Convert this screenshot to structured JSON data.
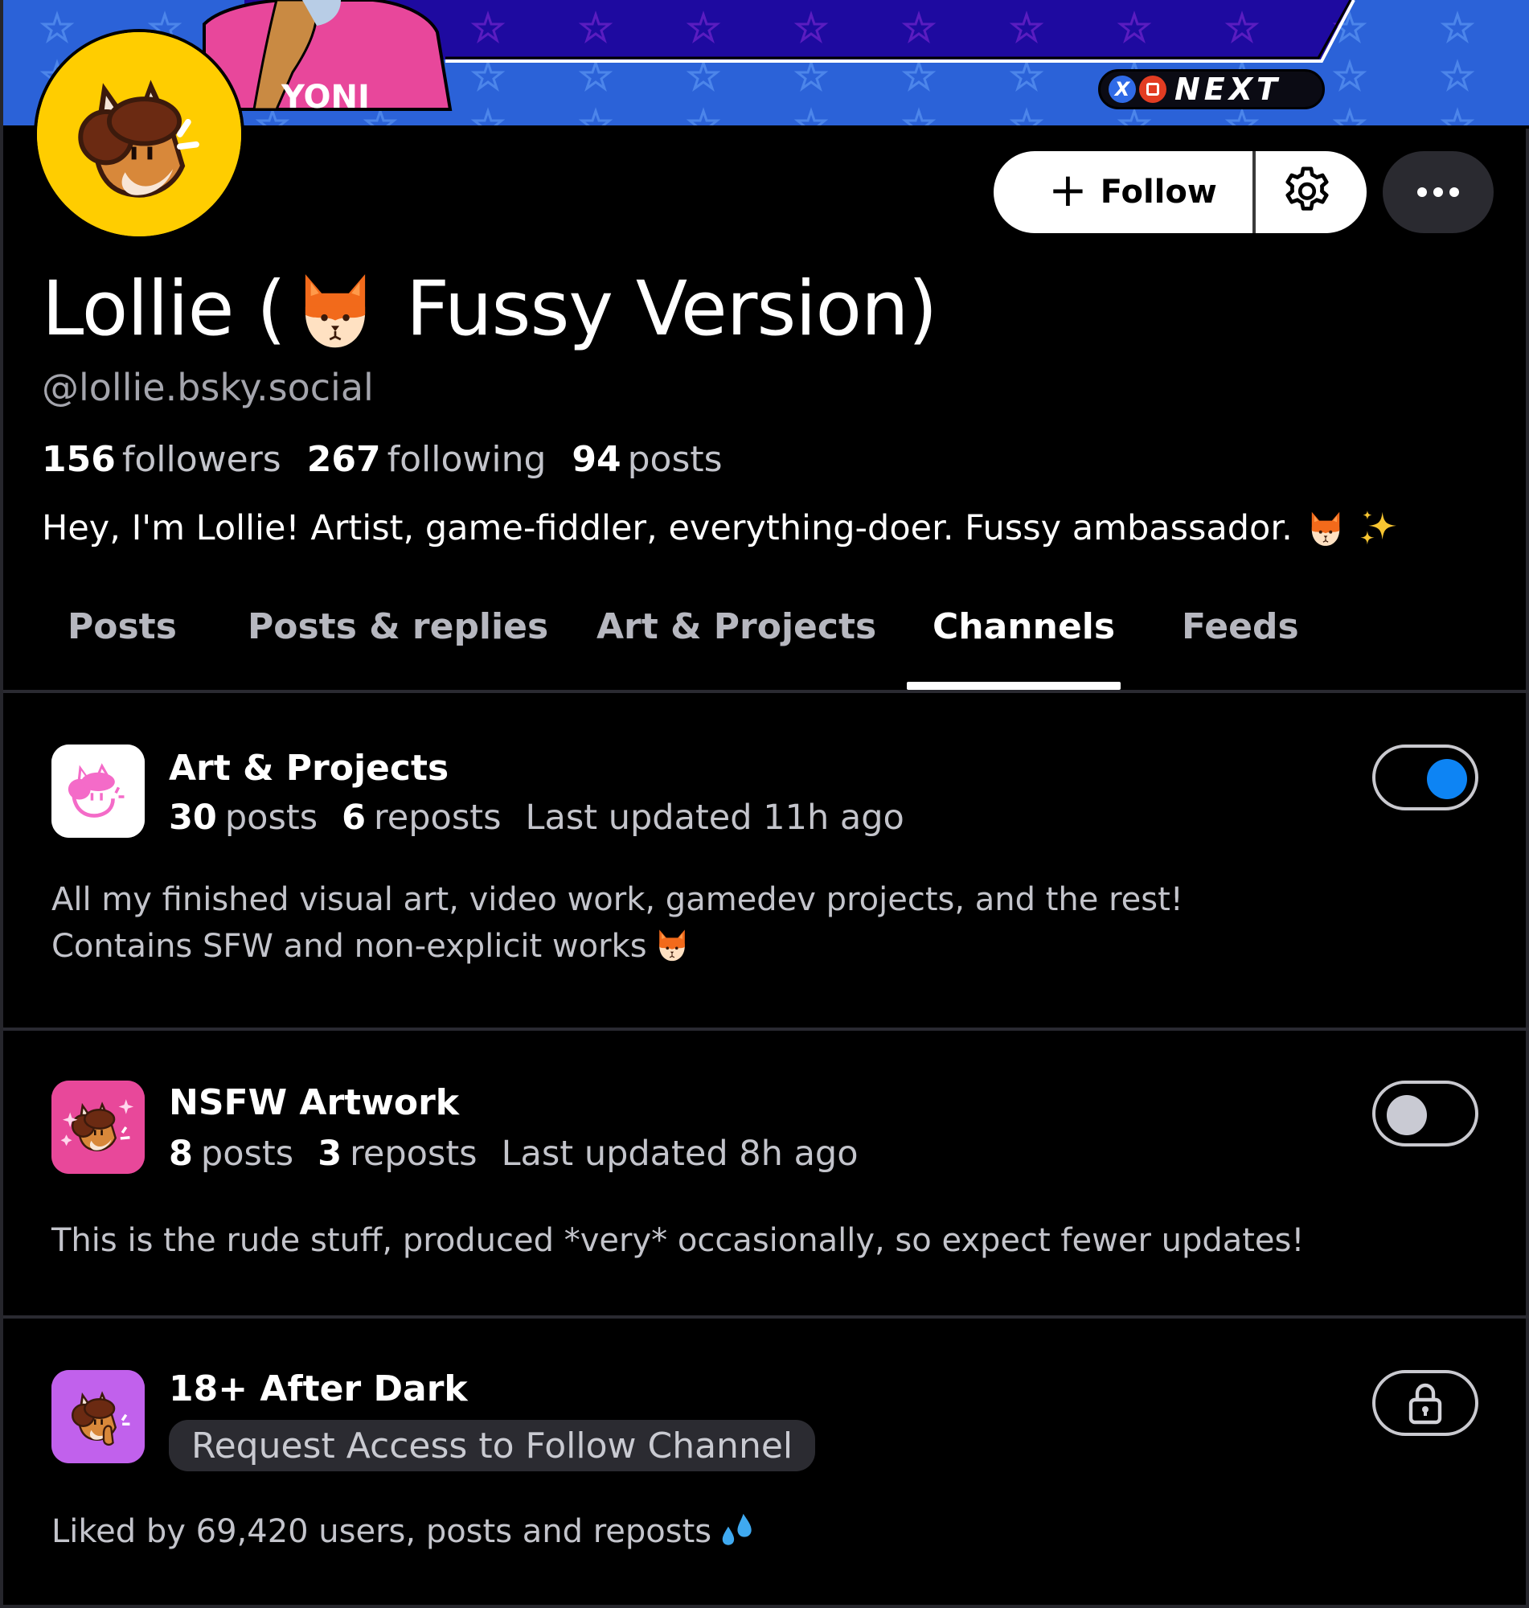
{
  "banner": {
    "badge_text": "NEXT",
    "badge_button_x": "X",
    "shirt_text": "YONI",
    "colors": {
      "sky": "#2b62d8",
      "panel": "#1e0aa0",
      "shirt": "#e8479b"
    }
  },
  "profile": {
    "display_name_before": "Lollie (",
    "display_name_emoji": "fox-face",
    "display_name_after": "Fussy Version)",
    "handle": "@lollie.bsky.social",
    "stats": {
      "followers_count": "156",
      "followers_label": "followers",
      "following_count": "267",
      "following_label": "following",
      "posts_count": "94",
      "posts_label": "posts"
    },
    "bio": "Hey, I'm Lollie! Artist, game-fiddler, everything-doer. Fussy ambassador.",
    "bio_emojis": [
      "fox-face",
      "sparkles"
    ],
    "avatar_bg": "#ffcd00"
  },
  "actions": {
    "follow_label": "Follow",
    "follow_icon": "plus-icon",
    "settings_icon": "gear-icon",
    "more_icon": "ellipsis-icon"
  },
  "tabs": [
    {
      "label": "Posts",
      "active": false
    },
    {
      "label": "Posts & replies",
      "active": false
    },
    {
      "label": "Art & Projects",
      "active": false
    },
    {
      "label": "Channels",
      "active": true
    },
    {
      "label": "Feeds",
      "active": false
    }
  ],
  "channels": [
    {
      "title": "Art & Projects",
      "posts_count": "30",
      "posts_label": "posts",
      "reposts_count": "6",
      "reposts_label": "reposts",
      "last_updated": "Last updated 11h ago",
      "description_lines": [
        "All my finished visual art, video work, gamedev projects, and the rest!",
        "Contains SFW and non-explicit works"
      ],
      "description_emoji": "fox-face",
      "avatar_bg": "#ffffff",
      "control": "toggle",
      "followed": true,
      "accent": "#0d84f4"
    },
    {
      "title": "NSFW Artwork",
      "posts_count": "8",
      "posts_label": "posts",
      "reposts_count": "3",
      "reposts_label": "reposts",
      "last_updated": "Last updated 8h ago",
      "description_lines": [
        "This is the rude stuff, produced *very* occasionally, so expect fewer updates!"
      ],
      "avatar_bg": "#e8489a",
      "control": "toggle",
      "followed": false
    },
    {
      "title": "18+ After Dark",
      "request_label": "Request Access to Follow Channel",
      "description_lines": [
        "Liked by 69,420 users, posts and reposts"
      ],
      "description_emoji": "sweat-droplets",
      "avatar_bg": "#c161ec",
      "control": "lock",
      "locked": true
    }
  ]
}
